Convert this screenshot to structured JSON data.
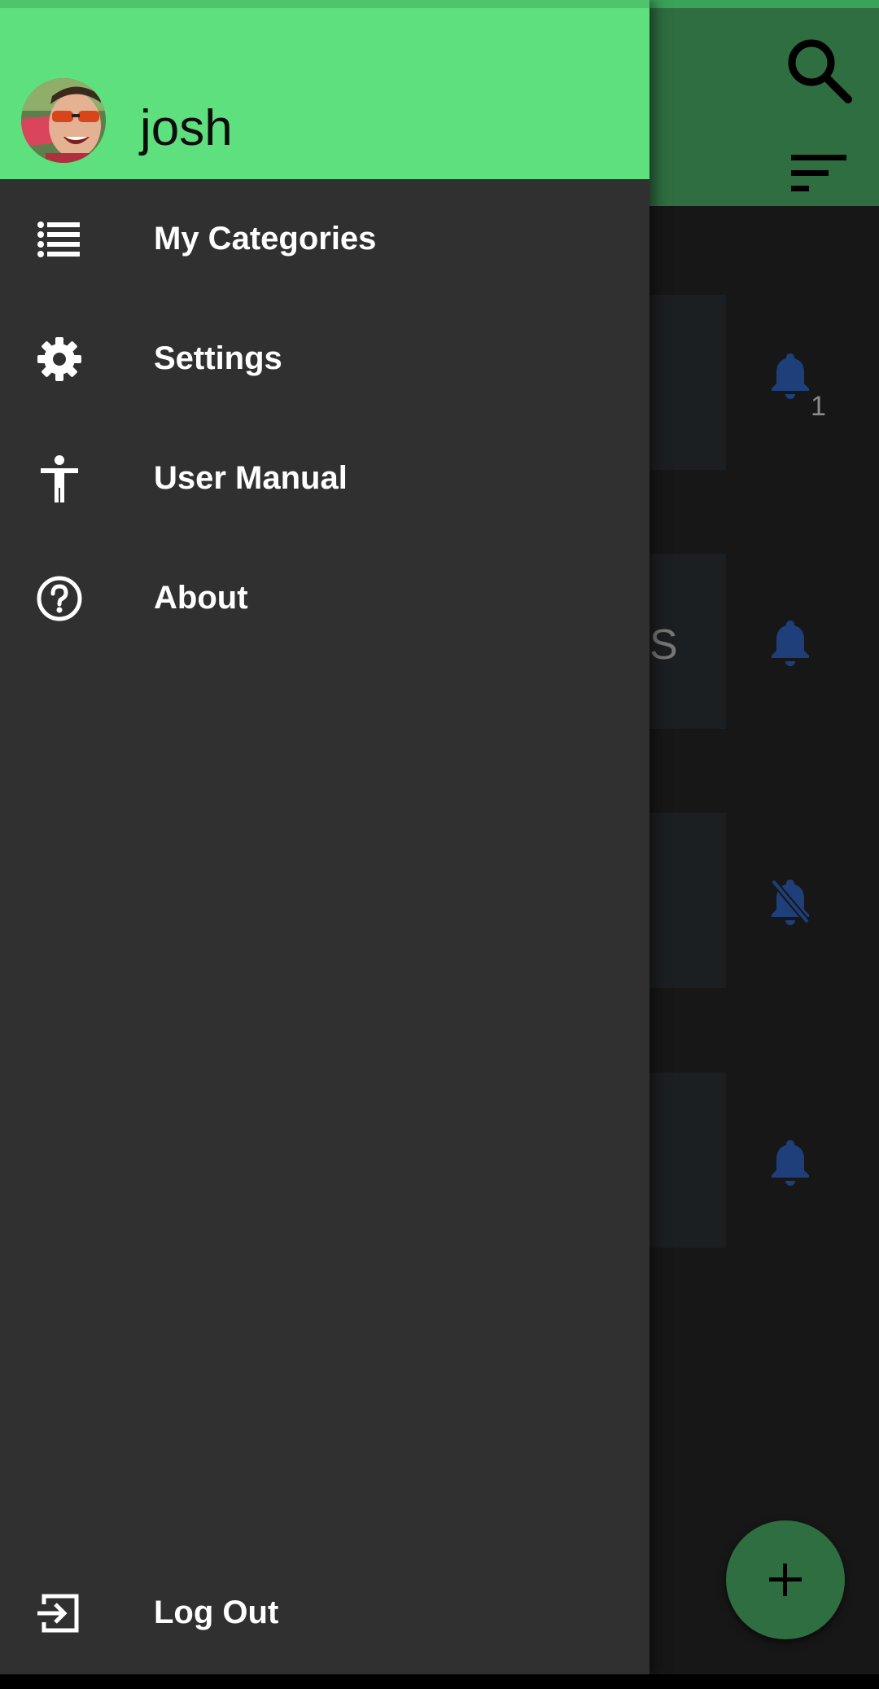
{
  "user": {
    "name": "josh"
  },
  "drawer": {
    "items": [
      {
        "label": "My Categories",
        "icon": "list-icon"
      },
      {
        "label": "Settings",
        "icon": "gear-icon"
      },
      {
        "label": "User Manual",
        "icon": "accessibility-icon"
      },
      {
        "label": "About",
        "icon": "help-circle-icon"
      }
    ],
    "logout": {
      "label": "Log Out",
      "icon": "logout-icon"
    }
  },
  "background": {
    "partial_text": "S",
    "badge_count": "1"
  },
  "colors": {
    "header_green": "#5ee07e",
    "appbar_green_dimmed": "#2e6e40",
    "drawer_bg": "#303030",
    "bell_blue": "#1e3f7a"
  }
}
